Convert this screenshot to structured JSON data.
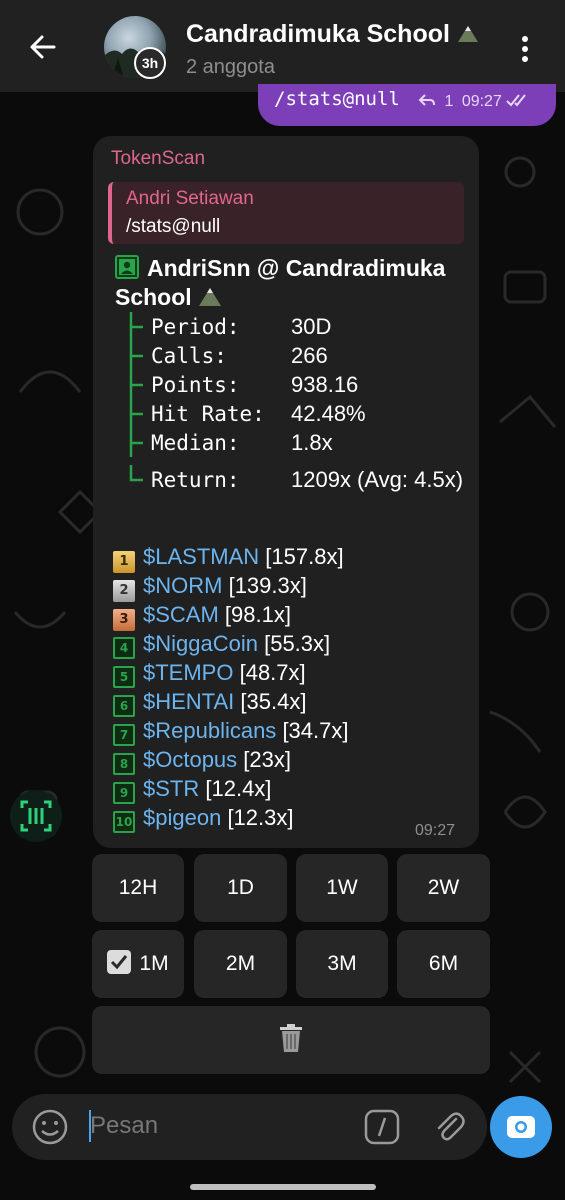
{
  "header": {
    "title": "Candradimuka School",
    "subtitle": "2 anggota",
    "story_badge": "3h"
  },
  "outgoing": {
    "text": "/stats@null",
    "reply_count": "1",
    "time": "09:27"
  },
  "incoming": {
    "bot_name": "TokenScan",
    "reply_to_name": "Andri Setiawan",
    "reply_to_text": "/stats@null",
    "user_line": "AndriSnn @ Candradimuka School",
    "stats": [
      {
        "label": "Period:",
        "value": "30D"
      },
      {
        "label": "Calls:",
        "value": "266"
      },
      {
        "label": "Points:",
        "value": "938.16"
      },
      {
        "label": "Hit Rate:",
        "value": "42.48%"
      },
      {
        "label": "Median:",
        "value": "1.8x"
      },
      {
        "label": "Return:",
        "value": ""
      }
    ],
    "return_text": "1209x (Avg: 4.5x)",
    "leaderboard": [
      {
        "rank": "1",
        "token": "$LASTMAN",
        "mult": "[157.8x]"
      },
      {
        "rank": "2",
        "token": "$NORM",
        "mult": "[139.3x]"
      },
      {
        "rank": "3",
        "token": "$SCAM",
        "mult": "[98.1x]"
      },
      {
        "rank": "4",
        "token": "$NiggaCoin",
        "mult": "[55.3x]"
      },
      {
        "rank": "5",
        "token": "$TEMPO",
        "mult": "[48.7x]"
      },
      {
        "rank": "6",
        "token": "$HENTAI",
        "mult": "[35.4x]"
      },
      {
        "rank": "7",
        "token": "$Republicans",
        "mult": "[34.7x]"
      },
      {
        "rank": "8",
        "token": "$Octopus",
        "mult": "[23x]"
      },
      {
        "rank": "9",
        "token": "$STR",
        "mult": "[12.4x]"
      },
      {
        "rank": "10",
        "token": "$pigeon",
        "mult": "[12.3x]"
      }
    ],
    "time": "09:27"
  },
  "keyboard": {
    "row1": [
      "12H",
      "1D",
      "1W",
      "2W"
    ],
    "row2": [
      "1M",
      "2M",
      "3M",
      "6M"
    ],
    "selected": "1M",
    "delete_icon": "trash-icon"
  },
  "input": {
    "placeholder": "Pesan"
  },
  "colors": {
    "accent_purple": "#7d3fb8",
    "bot_name_pink": "#e0678c",
    "token_blue": "#6cb4ee",
    "rank_green": "#2aa44a",
    "camera_blue": "#3a9be8"
  }
}
